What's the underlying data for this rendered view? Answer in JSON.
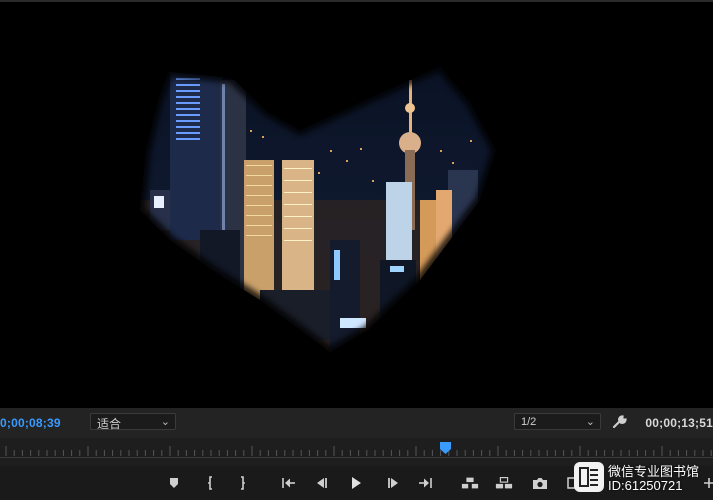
{
  "monitor": {
    "current_timecode": "0;00;08;39",
    "duration_timecode": "00;00;13;51",
    "fit_dropdown": {
      "selected": "适合"
    },
    "resolution_dropdown": {
      "selected": "1/2"
    },
    "playhead_position_fraction": 0.625
  },
  "transport": {
    "buttons": [
      {
        "name": "add-marker-icon"
      },
      {
        "name": "mark-in-icon"
      },
      {
        "name": "mark-out-icon"
      },
      {
        "name": "go-to-in-icon"
      },
      {
        "name": "step-back-icon"
      },
      {
        "name": "play-icon"
      },
      {
        "name": "step-forward-icon"
      },
      {
        "name": "go-to-out-icon"
      },
      {
        "name": "lift-icon"
      },
      {
        "name": "extract-icon"
      },
      {
        "name": "export-frame-icon"
      },
      {
        "name": "comparison-view-icon"
      },
      {
        "name": "add-button-icon"
      }
    ]
  },
  "watermark": {
    "line1": "微信专业图书馆",
    "line2": "ID:61250721"
  },
  "colors": {
    "timecode_current": "#3a9bff",
    "playhead": "#3a9bff",
    "panel_bg": "#232323"
  }
}
